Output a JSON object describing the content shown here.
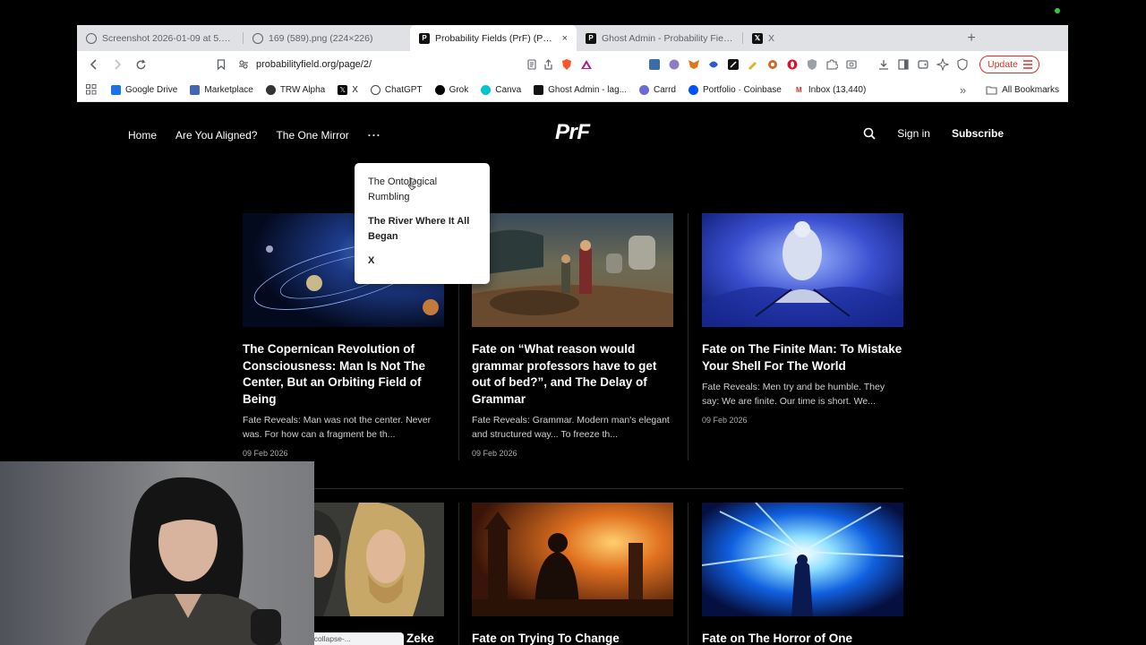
{
  "tabs": [
    {
      "title": "Screenshot 2026-01-09 at 5.18.12",
      "icon": "globe-icon",
      "active": false
    },
    {
      "title": "169 (589).png (224×226)",
      "icon": "globe-icon",
      "active": false
    },
    {
      "title": "Probability Fields (PrF) (Page 2)",
      "icon": "prf-favicon",
      "active": true,
      "close": "×"
    },
    {
      "title": "Ghost Admin - Probability Fields (PrF)",
      "icon": "prf-favicon",
      "active": false
    },
    {
      "title": "X",
      "icon": "x-favicon",
      "active": false
    }
  ],
  "toolbar": {
    "url": "probabilityfield.org/page/2/",
    "update_label": "Update"
  },
  "bookmarks": [
    {
      "label": "Google Drive",
      "icon": "drive-icon",
      "color": "#1a73e8"
    },
    {
      "label": "Marketplace",
      "icon": "marketplace-icon",
      "color": "#4267b2"
    },
    {
      "label": "TRW Alpha",
      "icon": "trw-icon",
      "color": "#333333"
    },
    {
      "label": "X",
      "icon": "x-icon",
      "color": "#000000"
    },
    {
      "label": "ChatGPT",
      "icon": "chatgpt-icon",
      "color": "#444444"
    },
    {
      "label": "Grok",
      "icon": "grok-icon",
      "color": "#000000"
    },
    {
      "label": "Canva",
      "icon": "canva-icon",
      "color": "#00c4cc"
    },
    {
      "label": "Ghost Admin - lag...",
      "icon": "ghost-icon",
      "color": "#111111"
    },
    {
      "label": "Carrd",
      "icon": "carrd-icon",
      "color": "#6b6bd6"
    },
    {
      "label": "Portfolio · Coinbase",
      "icon": "coinbase-icon",
      "color": "#0052ff"
    },
    {
      "label": "Inbox (13,440)",
      "icon": "gmail-icon",
      "color": "#d93025"
    }
  ],
  "bookmarks_more": "»",
  "all_bookmarks": "All Bookmarks",
  "site": {
    "nav": [
      "Home",
      "Are You Aligned?",
      "The One Mirror"
    ],
    "more": "···",
    "logo": "PrF",
    "sign_in": "Sign in",
    "subscribe": "Subscribe",
    "dropdown": [
      "The Ontological Rumbling",
      "The River Where It All Began",
      "X"
    ]
  },
  "posts": [
    {
      "title": "The Copernican Revolution of Consciousness: Man Is Not The Center, But an Orbiting Field of Being",
      "excerpt": "Fate Reveals: Man was not the center. Never was. For how can a fragment be th...",
      "date": "09 Feb 2026",
      "image": "space-galaxy"
    },
    {
      "title": "Fate on “What reason would grammar professors have to get out of bed?”, and The Delay of Grammar",
      "excerpt": "Fate Reveals: Grammar. Modern man's elegant and structured way... To freeze th...",
      "date": "09 Feb 2026",
      "image": "graveyard-scene"
    },
    {
      "title": "Fate on The Finite Man: To Mistake Your Shell For The World",
      "excerpt": "Fate Reveals: Men try and be humble. They say: We are finite. Our time is short. We...",
      "date": "09 Feb 2026",
      "image": "meditating-figure"
    },
    {
      "title": "Fate on ... Zeke",
      "title_visible": "Zeke",
      "image": "anime-zeke"
    },
    {
      "title": "Fate on Trying To Change",
      "image": "sunset-tower"
    },
    {
      "title": "Fate on The Horror of One",
      "image": "blue-light-figure"
    }
  ],
  "status_url": "probabilityfield.org/...fate-on-the-superposition-of-the-market-and-the-collapse-..."
}
